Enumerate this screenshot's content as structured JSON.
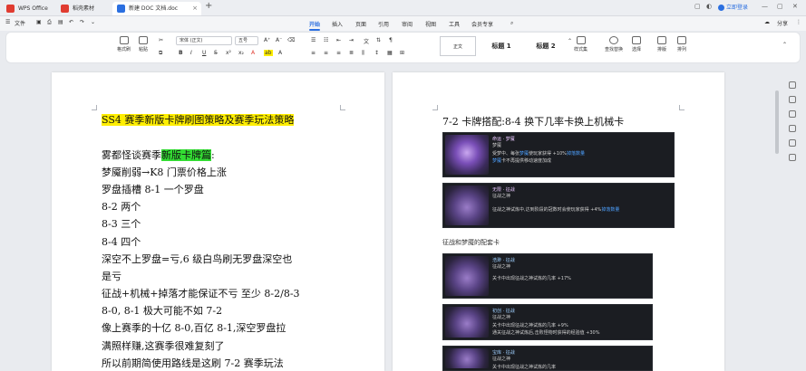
{
  "tabs": [
    {
      "label": "WPS Office",
      "color": "#e03c31",
      "active": false
    },
    {
      "label": "稻壳素材",
      "color": "#e03c31",
      "active": false
    },
    {
      "label": "新建 DOC 文档.doc",
      "color": "#2b6fe0",
      "active": true
    }
  ],
  "titlebar": {
    "add_tab": "+",
    "login_label": "立即登录"
  },
  "menubar": {
    "file_label": "文件",
    "items": [
      "开始",
      "插入",
      "页面",
      "引用",
      "审阅",
      "视图",
      "工具",
      "会员专享"
    ],
    "active_index": 0,
    "share_label": "分享"
  },
  "ribbon": {
    "format_painter": "格式刷",
    "paste": "粘贴",
    "font_name": "宋体 (正文)",
    "font_size": "五号",
    "styles": [
      "正文",
      "标题 1",
      "标题 2"
    ],
    "style_set": "样式集",
    "find_replace": "查找替换",
    "select": "选择",
    "layout": "排版",
    "sort": "排列"
  },
  "doc_left": {
    "lines": [
      {
        "text": "SS4 赛季新版卡牌刷图策略及赛季玩法策略",
        "highlight": "yellow"
      },
      {
        "text": "",
        "highlight": ""
      },
      {
        "pre": "雾都怪谈赛季",
        "hl": "新版卡牌篇",
        "post": ":"
      },
      {
        "text": "梦魇削弱→K8 门票价格上涨"
      },
      {
        "text": "罗盘插槽 8-1 一个罗盘"
      },
      {
        "text": "8-2  两个"
      },
      {
        "text": "8-3  三个"
      },
      {
        "text": "8-4  四个"
      },
      {
        "text": "深空不上罗盘=亏,6 级白鸟刷无罗盘深空也"
      },
      {
        "text": "是亏"
      },
      {
        "text": "征战+机械+掉落才能保证不亏  至少 8-2/8-3"
      },
      {
        "text": "8-0,  8-1  极大可能不如 7-2"
      },
      {
        "text": "像上赛季的十亿 8-0,百亿 8-1,深空罗盘拉"
      },
      {
        "text": "满照样赚,这赛季很难复刻了"
      },
      {
        "text": "所以前期简使用路线是这刷 7-2  赛季玩法"
      }
    ]
  },
  "doc_right": {
    "heading": "7-2 卡牌搭配:8-4 换下几率卡换上机械卡",
    "subheading": "征战和梦魇的配套卡",
    "cards_top": [
      {
        "name": "命运 · 梦魇",
        "type": "梦魇",
        "desc1_a": "受梦中、每张",
        "desc1_b": "梦魇",
        "desc1_c": "使玩家获得 +10%",
        "desc1_d": "掉落数量",
        "desc2_a": "梦魇",
        "desc2_b": "卡不再提供移动速度加成"
      },
      {
        "name": "无限 · 征战",
        "type": "征战之神",
        "desc1_a": "征战之神试炼中,达到阶段的冠数时会使玩家获得 +4%",
        "desc1_b": "掉落数量"
      }
    ],
    "cards_bottom": [
      {
        "name": "浩渺 · 征战",
        "type": "征战之神",
        "desc1_a": "关卡中出现征战之神试炼的几率 +17%"
      },
      {
        "name": "初创 · 征战",
        "type": "征战之神",
        "desc1_a": "关卡中出现征战之神试炼的几率 +9%",
        "desc2_a": "通关征战之神试炼后,击败怪物时获得的经验值 +30%"
      },
      {
        "name": "宝库 · 征战",
        "type": "征战之神",
        "desc1_a": "关卡中出现征战之神试炼的几率"
      }
    ]
  }
}
